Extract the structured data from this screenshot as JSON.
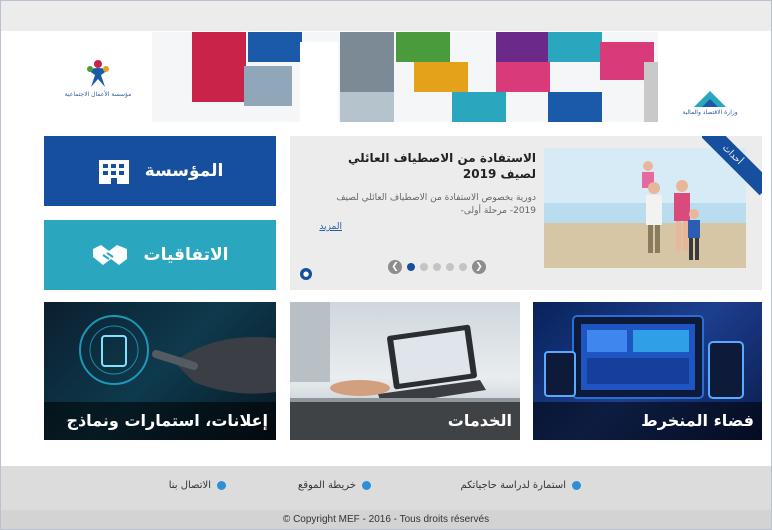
{
  "banner": {
    "logo_left_text": "مؤسسة الأعمال الاجتماعية",
    "logo_right_text": "وزارة الاقتصاد والمالية",
    "tile_colors": [
      "#c9234a",
      "#1b5aa8",
      "#4a9b3c",
      "#6b2a8a",
      "#e3a21a",
      "#2aa7bf",
      "#8c8c8c",
      "#d83a7a"
    ]
  },
  "nav": {
    "foundation_label": "المؤسسة",
    "agreements_label": "الاتفاقيات"
  },
  "slider": {
    "ribbon": "أحداث",
    "title": "الاستفادة من الاصطياف العائلي لصيف 2019",
    "description": "دورية بخصوص الاستفادة من الاصطياف العائلي لصيف 2019- مرحلة أولى-",
    "more_link": "المزيد",
    "slide_count": 5,
    "active_slide": 1
  },
  "tiles": {
    "announcements": "إعلانات، استمارات ونماذج",
    "services": "الخدمات",
    "members_space": "فضاء المنخرط"
  },
  "footer": {
    "links": [
      "استمارة لدراسة حاجياتكم",
      "خريطة الموقع",
      "الاتصال بنا"
    ],
    "copyright": "© Copyright MEF - 2016 - Tous droits réservés"
  },
  "colors": {
    "primary_blue": "#164f9e",
    "teal": "#2aa7bf"
  }
}
